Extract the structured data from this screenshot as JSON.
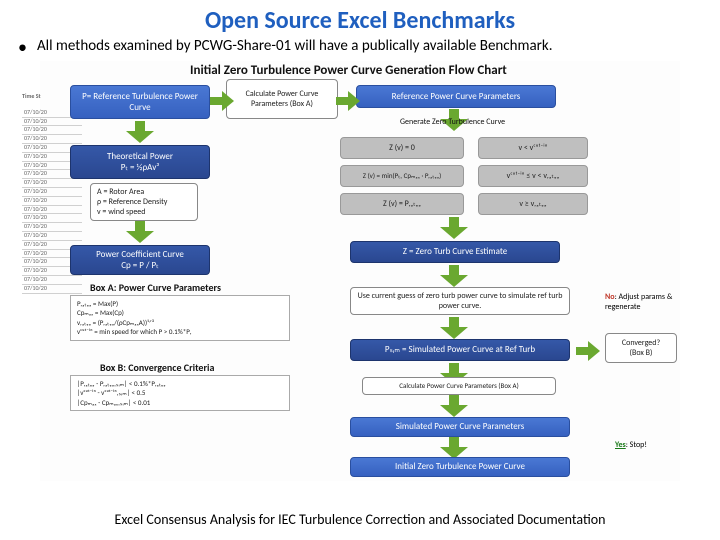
{
  "title": "Open Source Excel Benchmarks",
  "bullet": "All methods examined by PCWG-Share-01 will have a publically available Benchmark.",
  "flowchart": {
    "title": "Initial Zero Turbulence Power Curve Generation Flow Chart",
    "boxes": {
      "ref_turb_pc": "P= Reference Turbulence Power Curve",
      "calc_params": "Calculate Power Curve Parameters (Box A)",
      "ref_pc_params": "Reference Power Curve Parameters",
      "gen_zero_curve": "Generate Zero Turbulence Curve",
      "theoretical": "Theoretical Power\nPₜ = ½ρAv³",
      "vars": "A = Rotor Area\nρ = Reference Density\nv = wind speed",
      "coeff_curve": "Power Coefficient Curve\nCp = P / Pₜ",
      "z1": "Z (v) = 0",
      "z1_cond": "v < vᶜᵘᵗ⁻ⁱⁿ",
      "z2": "Z (v) = min(Pₜ, Cpₘₐₓ · Pᵣₐₜₑₔ)",
      "z2_cond": "vᶜᵘᵗ⁻ⁱⁿ ≤ v < vᵣₐₜₑₔ",
      "z3": "Z (v) = Pᵣₐₜₑₔ",
      "z3_cond": "v ≥ vᵣₐₜₑₔ",
      "boxA_label": "Box A: Power Curve Parameters",
      "boxA_formulas": "Pᵣₐₜₑₔ = Max(P)\nCpₘₐₓ = Max(Cp)\nvᵣₐₜₑₔ = (Pᵣₐₜₑₔ/(ρCpₘₐₓA))¹ᐟ³\nvᶜᵘᵗ⁻ⁱⁿ = min speed for which P > 0.1%*Pᵣ",
      "boxB_label": "Box B: Convergence Criteria",
      "boxB_formulas": "|Pᵣₐₜₑₔ - Pᵣₐₜₑₔ,ₛᵢₘ| < 0.1%*Pᵣₐₜₑₔ\n|vᶜᵘᵗ⁻ⁱⁿ - vᶜᵘᵗ⁻ⁱⁿ,ₛᵢₘ| < 0.5\n|Cpₘₐₓ - Cpₘₐₓ,ₛᵢₘ| < 0.01",
      "z_est": "Z = Zero Turb Curve Estimate",
      "simulate": "Use current guess of zero turb power curve to simulate ref turb power curve.",
      "psim": "Pₛᵢₘ = Simulated Power Curve at Ref Turb",
      "calc_params2": "Calculate Power Curve Parameters (Box A)",
      "sim_params": "Simulated Power Curve Parameters",
      "initial_zero": "Initial Zero Turbulence Power Curve",
      "converged_q": "Converged?\n(Box B)",
      "no_adjust": "No: Adjust params & regenerate",
      "yes_stop": "Yes: Stop!"
    }
  },
  "caption": "Excel Consensus Analysis for IEC Turbulence Correction and Associated Documentation",
  "excel_label": "Time St",
  "excel_dates": [
    "07/10/20",
    "07/10/20",
    "07/10/20",
    "07/10/20",
    "07/10/20",
    "07/10/20",
    "07/10/20",
    "07/10/20",
    "07/10/20",
    "07/10/20",
    "07/10/20",
    "07/10/20",
    "07/10/20",
    "07/10/20",
    "07/10/20",
    "07/10/20",
    "07/10/20",
    "07/10/20",
    "07/10/20",
    "07/10/20",
    "07/10/20"
  ]
}
